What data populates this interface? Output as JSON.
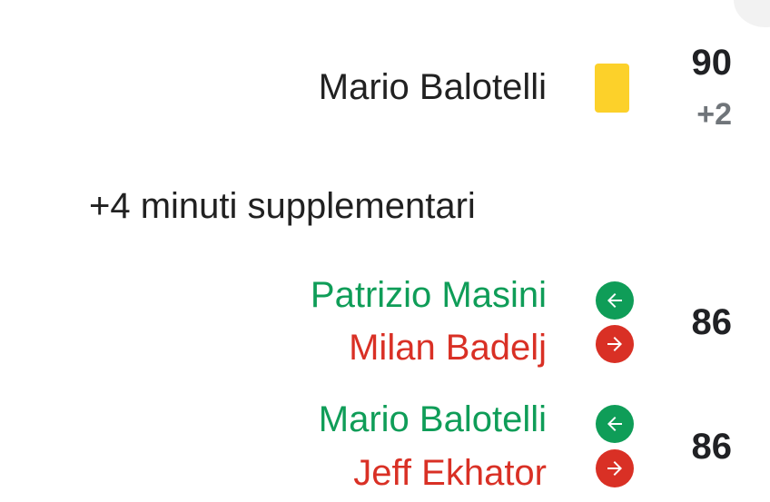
{
  "events": {
    "card": {
      "player": "Mario Balotelli",
      "card_type": "yellow",
      "card_color": "#fcd12a",
      "minute": "90",
      "added": "+2"
    },
    "stoppage_note": "+4 minuti supplementari",
    "sub1": {
      "player_in": "Patrizio Masini",
      "player_out": "Milan Badelj",
      "minute": "86",
      "in_icon": "arrow-left-icon",
      "out_icon": "arrow-right-icon"
    },
    "sub2": {
      "player_in": "Mario Balotelli",
      "player_out": "Jeff Ekhator",
      "minute": "86",
      "in_icon": "arrow-left-icon",
      "out_icon": "arrow-right-icon"
    }
  },
  "colors": {
    "sub_in": "#0f9d58",
    "sub_out": "#d93025",
    "text": "#212121",
    "added_time": "#70757a"
  }
}
